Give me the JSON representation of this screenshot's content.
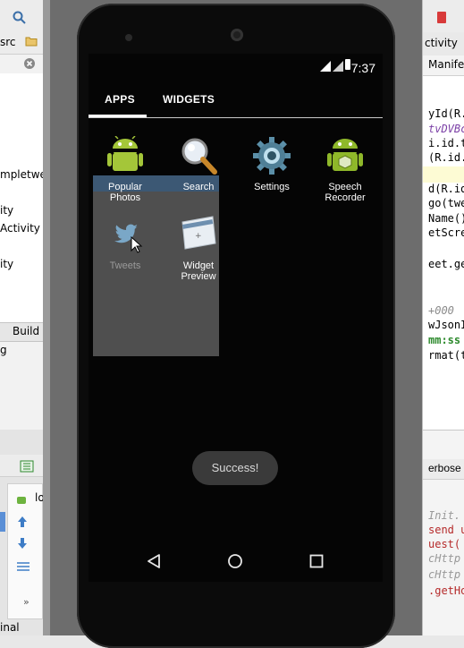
{
  "ide_left": {
    "rows": [
      "src",
      "mpletwee",
      "ity",
      "Activity",
      "ity",
      "Build V",
      "g",
      "lo",
      "inal"
    ]
  },
  "ide_right": {
    "tab_top": "ctivity",
    "tab_second": "Manifest",
    "code": [
      "yId(R.",
      "tvDVBc",
      "i.id.tw",
      "(R.id.",
      "d(R.id",
      "go(twe",
      "Name()",
      "etScre",
      "eet.ge",
      "+000",
      "wJsonI",
      "mm:ss",
      "rmat(t",
      "erbose",
      "Init.",
      "send u",
      "uest(",
      "cHttp",
      "cHttp",
      ".getHo"
    ]
  },
  "phone": {
    "status": {
      "time": "7:37"
    },
    "tabs": {
      "apps": "APPS",
      "widgets": "WIDGETS"
    },
    "apps": [
      {
        "name": "Popular Photos",
        "icon": "android-icon"
      },
      {
        "name": "Search",
        "icon": "magnifier-icon"
      },
      {
        "name": "Settings",
        "icon": "gear-icon"
      },
      {
        "name": "Speech Recorder",
        "icon": "android-box-icon"
      }
    ],
    "drag": {
      "items": [
        {
          "name": "Tweets",
          "icon": "twitter-bird-icon"
        },
        {
          "name": "Widget Preview",
          "icon": "widget-preview-icon"
        }
      ]
    },
    "toast": "Success!",
    "nav": [
      "back-icon",
      "home-icon",
      "recents-icon"
    ]
  }
}
